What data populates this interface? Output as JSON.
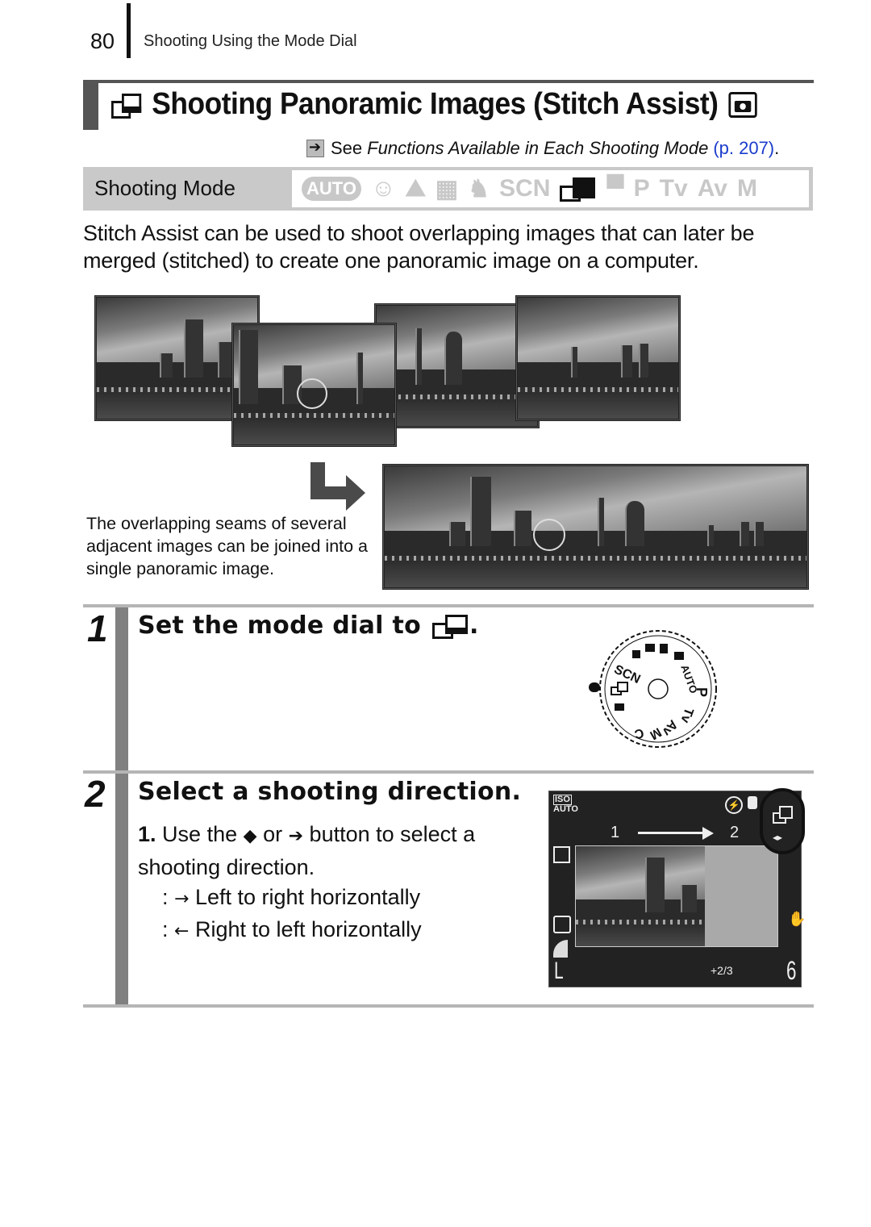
{
  "header": {
    "page_number": "80",
    "section": "Shooting Using the Mode Dial"
  },
  "title": {
    "icon": "stitch-assist-icon",
    "text": "Shooting Panoramic Images (Stitch Assist)",
    "trailing_icon": "camera-mode-icon"
  },
  "reference": {
    "icon": "arrow-right-box-icon",
    "prefix": "See",
    "italic": "Functions Available in Each Shooting Mode",
    "link": "(p. 207)",
    "suffix": ".",
    "link_color": "#1a3ccc"
  },
  "shooting_mode": {
    "label": "Shooting Mode",
    "modes": [
      {
        "name": "AUTO",
        "active": false
      },
      {
        "name": "portrait-icon",
        "glyph": "☺",
        "active": false
      },
      {
        "name": "landscape-icon",
        "glyph": "⛰",
        "active": false
      },
      {
        "name": "night-scene-icon",
        "glyph": "▦",
        "active": false
      },
      {
        "name": "kids-pets-icon",
        "glyph": "♞",
        "active": false
      },
      {
        "name": "SCN",
        "active": false
      },
      {
        "name": "stitch-assist-icon",
        "active": true
      },
      {
        "name": "movie-icon",
        "glyph": "▀",
        "active": false
      },
      {
        "name": "P",
        "active": false
      },
      {
        "name": "Tv",
        "active": false
      },
      {
        "name": "Av",
        "active": false
      },
      {
        "name": "M",
        "active": false
      }
    ]
  },
  "intro": "Stitch Assist can be used to shoot overlapping images that can later be merged (stitched) to create one panoramic image on a computer.",
  "caption": "The overlapping seams of several adjacent images can be joined into a single panoramic image.",
  "steps": [
    {
      "number": "1",
      "title": "Set the mode dial to",
      "title_icon": "stitch-assist-icon",
      "title_suffix": ".",
      "dial_labels": [
        "SCN",
        "AUTO",
        "P",
        "Tv",
        "Av",
        "M",
        "C"
      ]
    },
    {
      "number": "2",
      "title": "Select a shooting direction.",
      "substep_number": "1.",
      "substep_text_a": "Use the",
      "left_button": "◆",
      "substep_or": "or",
      "right_button": "➔",
      "substep_text_b": "button to select a shooting direction.",
      "directions": [
        {
          "arrow": "→",
          "label": "Left to right horizontally"
        },
        {
          "arrow": "←",
          "label": "Right to left horizontally"
        }
      ]
    }
  ],
  "lcd": {
    "iso": "ISO",
    "iso_value": "AUTO",
    "frame_from": "1",
    "frame_to": "2",
    "exposure_comp": "+2/3",
    "size": "L",
    "shots_remaining": "6",
    "direction_indicator": "◂▸"
  }
}
